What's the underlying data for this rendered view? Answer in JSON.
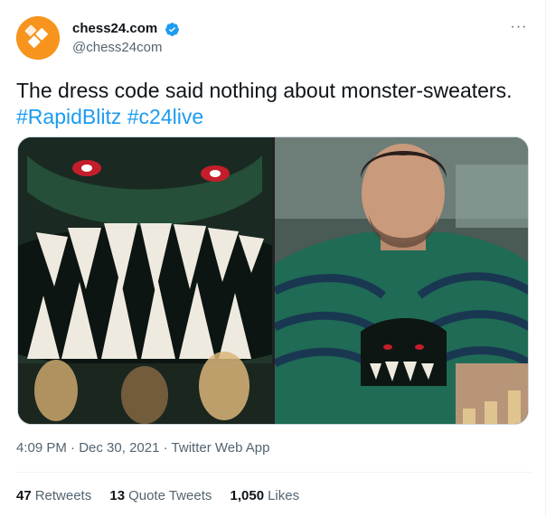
{
  "author": {
    "display_name": "chess24.com",
    "handle": "@chess24com",
    "verified_icon": "verified-badge-icon",
    "avatar_icon": "chess24-logo-icon"
  },
  "more_label": "···",
  "tweet": {
    "text_line1": "The dress code said nothing about monster-sweaters.",
    "hashtag1": "#RapidBlitz",
    "hashtag2": "#c24live"
  },
  "meta": {
    "time": "4:09 PM",
    "date": "Dec 30, 2021",
    "separator": "·",
    "source": "Twitter Web App"
  },
  "stats": {
    "retweets_count": "47",
    "retweets_label": "Retweets",
    "quotes_count": "13",
    "quotes_label": "Quote Tweets",
    "likes_count": "1,050",
    "likes_label": "Likes"
  },
  "colors": {
    "accent": "#1d9bf0",
    "secondary_text": "#536471",
    "avatar_bg": "#f7941d"
  }
}
